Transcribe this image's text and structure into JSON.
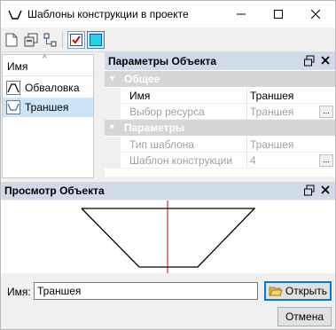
{
  "window": {
    "title": "Шаблоны конструкции в проекте",
    "controls": {
      "minimize": "minimize",
      "maximize": "maximize",
      "close": "close"
    }
  },
  "toolbar": {
    "icons": [
      "new-document-icon",
      "copy-icon",
      "tree-icon",
      "check-icon",
      "fill-icon"
    ]
  },
  "list": {
    "header": "Имя",
    "sort_glyph": "^",
    "items": [
      {
        "label": "Обваловка",
        "icon": "embankment-icon",
        "selected": false
      },
      {
        "label": "Траншея",
        "icon": "trench-icon",
        "selected": true
      }
    ]
  },
  "properties": {
    "title": "Параметры Объекта",
    "categories": [
      {
        "label": "Общее",
        "rows": [
          {
            "name": "Имя",
            "value": "Траншея",
            "enabled": true,
            "button": ""
          },
          {
            "name": "Выбор ресурса",
            "value": "Траншея",
            "enabled": false,
            "button": "..."
          }
        ]
      },
      {
        "label": "Параметры",
        "rows": [
          {
            "name": "Тип шаблона",
            "value": "Траншея",
            "enabled": false,
            "button": ""
          },
          {
            "name": "Шаблон конструкции",
            "value": "4",
            "enabled": false,
            "button": "..."
          }
        ]
      }
    ]
  },
  "preview": {
    "title": "Просмотр Объекта"
  },
  "footer": {
    "name_label": "Имя:",
    "name_value": "Траншея",
    "open_label": "Открыть",
    "cancel_label": "Отмена"
  },
  "colors": {
    "panel_header": "#cfdbe8",
    "category": "#d6d6d6",
    "selection": "#cce4f7",
    "accent": "#0078d7",
    "axis_line": "#c00000"
  }
}
